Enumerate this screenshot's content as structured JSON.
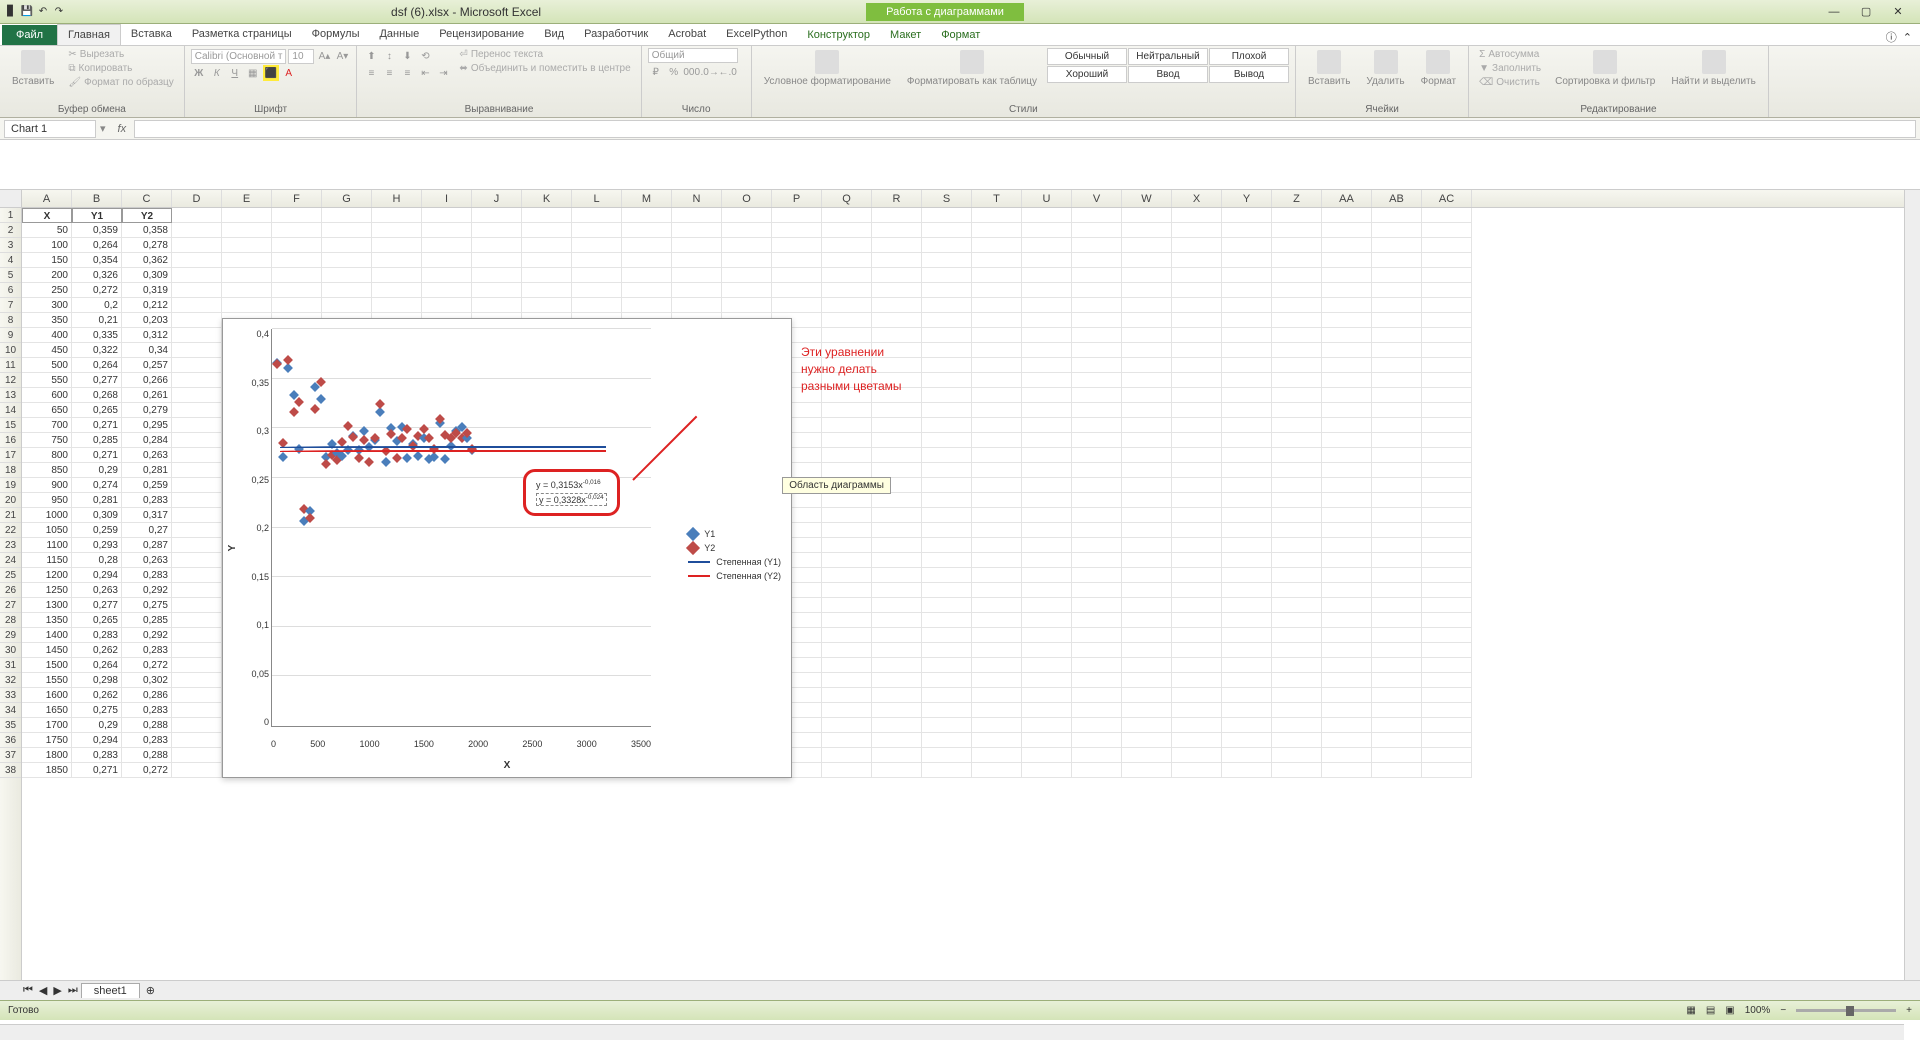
{
  "titlebar": {
    "filename": "dsf (6).xlsx - Microsoft Excel",
    "chart_tools": "Работа с диаграммами"
  },
  "tabs": {
    "file": "Файл",
    "list": [
      "Главная",
      "Вставка",
      "Разметка страницы",
      "Формулы",
      "Данные",
      "Рецензирование",
      "Вид",
      "Разработчик",
      "Acrobat",
      "ExcelPython"
    ],
    "ctx": [
      "Конструктор",
      "Макет",
      "Формат"
    ]
  },
  "ribbon": {
    "clipboard": {
      "label": "Буфер обмена",
      "paste": "Вставить",
      "cut": "Вырезать",
      "copy": "Копировать",
      "format_painter": "Формат по образцу"
    },
    "font": {
      "label": "Шрифт",
      "family": "Calibri (Основной т",
      "size": "10"
    },
    "alignment": {
      "label": "Выравнивание",
      "wrap": "Перенос текста",
      "merge": "Объединить и поместить в центре"
    },
    "number": {
      "label": "Число",
      "format": "Общий"
    },
    "styles": {
      "label": "Стили",
      "cond": "Условное форматирование",
      "table": "Форматировать как таблицу",
      "gallery": [
        "Обычный",
        "Нейтральный",
        "Плохой",
        "Хороший",
        "Ввод",
        "Вывод"
      ]
    },
    "cells": {
      "label": "Ячейки",
      "insert": "Вставить",
      "delete": "Удалить",
      "format": "Формат"
    },
    "editing": {
      "label": "Редактирование",
      "autosum": "Автосумма",
      "fill": "Заполнить",
      "clear": "Очистить",
      "sort": "Сортировка и фильтр",
      "find": "Найти и выделить"
    }
  },
  "name_box": "Chart 1",
  "columns": [
    "A",
    "B",
    "C",
    "D",
    "E",
    "F",
    "G",
    "H",
    "I",
    "J",
    "K",
    "L",
    "M",
    "N",
    "O",
    "P",
    "Q",
    "R",
    "S",
    "T",
    "U",
    "V",
    "W",
    "X",
    "Y",
    "Z",
    "AA",
    "AB",
    "AC"
  ],
  "spreadsheet": {
    "headers": [
      "X",
      "Y1",
      "Y2"
    ],
    "rows": [
      [
        50,
        "0,359",
        "0,358"
      ],
      [
        100,
        "0,264",
        "0,278"
      ],
      [
        150,
        "0,354",
        "0,362"
      ],
      [
        200,
        "0,326",
        "0,309"
      ],
      [
        250,
        "0,272",
        "0,319"
      ],
      [
        300,
        "0,2",
        "0,212"
      ],
      [
        350,
        "0,21",
        "0,203"
      ],
      [
        400,
        "0,335",
        "0,312"
      ],
      [
        450,
        "0,322",
        "0,34"
      ],
      [
        500,
        "0,264",
        "0,257"
      ],
      [
        550,
        "0,277",
        "0,266"
      ],
      [
        600,
        "0,268",
        "0,261"
      ],
      [
        650,
        "0,265",
        "0,279"
      ],
      [
        700,
        "0,271",
        "0,295"
      ],
      [
        750,
        "0,285",
        "0,284"
      ],
      [
        800,
        "0,271",
        "0,263"
      ],
      [
        850,
        "0,29",
        "0,281"
      ],
      [
        900,
        "0,274",
        "0,259"
      ],
      [
        950,
        "0,281",
        "0,283"
      ],
      [
        1000,
        "0,309",
        "0,317"
      ],
      [
        1050,
        "0,259",
        "0,27"
      ],
      [
        1100,
        "0,293",
        "0,287"
      ],
      [
        1150,
        "0,28",
        "0,263"
      ],
      [
        1200,
        "0,294",
        "0,283"
      ],
      [
        1250,
        "0,263",
        "0,292"
      ],
      [
        1300,
        "0,277",
        "0,275"
      ],
      [
        1350,
        "0,265",
        "0,285"
      ],
      [
        1400,
        "0,283",
        "0,292"
      ],
      [
        1450,
        "0,262",
        "0,283"
      ],
      [
        1500,
        "0,264",
        "0,272"
      ],
      [
        1550,
        "0,298",
        "0,302"
      ],
      [
        1600,
        "0,262",
        "0,286"
      ],
      [
        1650,
        "0,275",
        "0,283"
      ],
      [
        1700,
        "0,29",
        "0,288"
      ],
      [
        1750,
        "0,294",
        "0,283"
      ],
      [
        1800,
        "0,283",
        "0,288"
      ],
      [
        1850,
        "0,271",
        "0,272"
      ]
    ]
  },
  "chart_data": {
    "type": "scatter",
    "xlabel": "X",
    "ylabel": "Y",
    "xlim": [
      0,
      3500
    ],
    "ylim": [
      0,
      0.4
    ],
    "xticks": [
      0,
      500,
      1000,
      1500,
      2000,
      2500,
      3000,
      3500
    ],
    "yticks": [
      "0",
      "0,05",
      "0,1",
      "0,15",
      "0,2",
      "0,25",
      "0,3",
      "0,35",
      "0,4"
    ],
    "series": [
      {
        "name": "Y1",
        "type": "scatter",
        "color": "#4a7ebb"
      },
      {
        "name": "Y2",
        "type": "scatter",
        "color": "#be4b48"
      },
      {
        "name": "Степенная (Y1)",
        "type": "line",
        "color": "#1f4e9b"
      },
      {
        "name": "Степенная (Y2)",
        "type": "line",
        "color": "#d22"
      }
    ],
    "equations": [
      "y = 0,3153x⁻⁰·⁰¹⁶",
      "y = 0,3328x⁻⁰·⁰²⁴"
    ],
    "annotation": "Эти уравнении нужно делать разными цветамы",
    "tooltip": "Область диаграммы"
  },
  "sheet_tab": "sheet1",
  "status": {
    "ready": "Готово",
    "zoom": "100%"
  }
}
